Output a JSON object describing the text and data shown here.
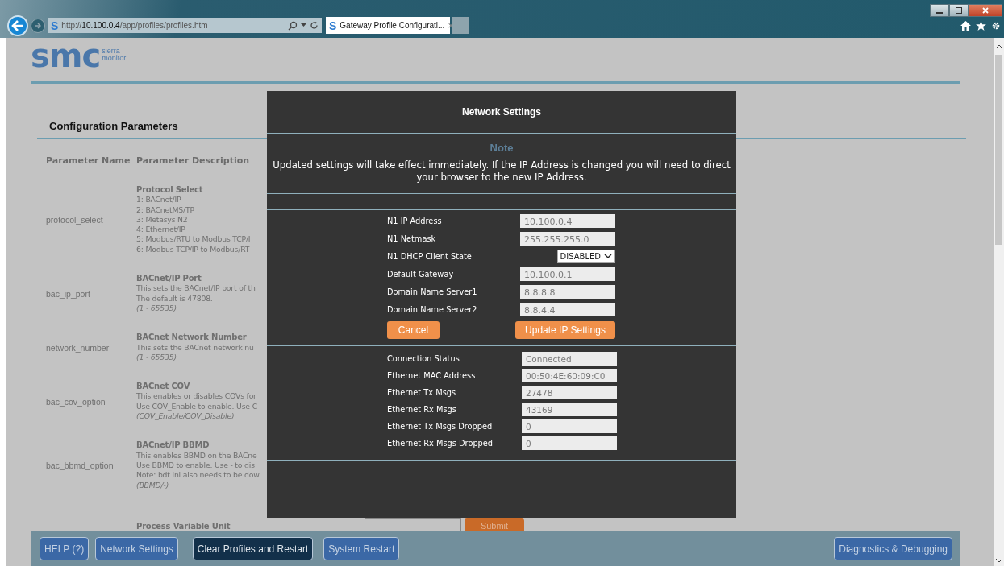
{
  "browser": {
    "favicon": "S",
    "tab_favicon": "S",
    "address_host": "10.100.0.4",
    "address_prefix": "http://",
    "address_path": "/app/profiles/profiles.htm",
    "tab_title": "Gateway Profile Configurati...",
    "tab_close": "×"
  },
  "logo": {
    "letters": "smc",
    "tagline_1": "sierra",
    "tagline_2": "monitor"
  },
  "page": {
    "heading": "Configuration Parameters",
    "columns": [
      "Parameter Name",
      "Parameter Description"
    ],
    "rows": [
      {
        "name": "protocol_select",
        "title": "Protocol Select",
        "lines": [
          "1: BACnet/IP",
          "2: BACnetMS/TP",
          "3: Metasys N2",
          "4: Ethernet/IP",
          "5: Modbus/RTU to Modbus TCP/I",
          "6: Modbus TCP/IP to Modbus/RT"
        ],
        "range": ""
      },
      {
        "name": "bac_ip_port",
        "title": "BACnet/IP Port",
        "lines": [
          "This sets the BACnet/IP port of th",
          "The default is 47808."
        ],
        "range": "(1 - 65535)"
      },
      {
        "name": "network_number",
        "title": "BACnet Network Number",
        "lines": [
          "This sets the BACnet network nu"
        ],
        "range": "(1 - 65535)"
      },
      {
        "name": "bac_cov_option",
        "title": "BACnet COV",
        "lines": [
          "This enables or disables COVs for",
          "Use COV_Enable to enable. Use C"
        ],
        "range": "(COV_Enable/COV_Disable)"
      },
      {
        "name": "bac_bbmd_option",
        "title": "BACnet/IP BBMD",
        "lines": [
          "This enables BBMD on the BACne",
          "Use BBMD to enable. Use - to dis",
          "Note: bdt.ini also needs to be dow"
        ],
        "range": "(BBMD/-)"
      },
      {
        "name": "",
        "title": "Process Variable Unit",
        "lines": [],
        "range": "",
        "submit": "Submit"
      }
    ]
  },
  "modal": {
    "title": "Network Settings",
    "note_heading": "Note",
    "note": "Updated settings will take effect immediately. If the IP Address is changed you will need to direct your browser to the new IP Address.",
    "settings": [
      {
        "kind": "text",
        "label": "N1 IP Address",
        "value": "10.100.0.4"
      },
      {
        "kind": "text",
        "label": "N1 Netmask",
        "value": "255.255.255.0"
      },
      {
        "kind": "select",
        "label": "N1 DHCP Client State",
        "value": "DISABLED"
      },
      {
        "kind": "text",
        "label": "Default Gateway",
        "value": "10.100.0.1"
      },
      {
        "kind": "text",
        "label": "Domain Name Server1",
        "value": "8.8.8.8"
      },
      {
        "kind": "text",
        "label": "Domain Name Server2",
        "value": "8.8.4.4"
      }
    ],
    "buttons": [
      "Cancel",
      "Update IP Settings"
    ],
    "status": [
      {
        "label": "Connection Status",
        "value": "Connected"
      },
      {
        "label": "Ethernet MAC Address",
        "value": "00:50:4E:60:09:C0"
      },
      {
        "label": "Ethernet Tx Msgs",
        "value": "27478"
      },
      {
        "label": "Ethernet Rx Msgs",
        "value": "43169"
      },
      {
        "label": "Ethernet Tx Msgs Dropped",
        "value": "0"
      },
      {
        "label": "Ethernet Rx Msgs Dropped",
        "value": "0"
      }
    ]
  },
  "footer": {
    "buttons": [
      {
        "label": "HELP (?)",
        "selected": false
      },
      {
        "label": "Network Settings",
        "selected": false
      },
      {
        "label": "Clear Profiles and Restart",
        "selected": true
      },
      {
        "label": "System Restart",
        "selected": false
      }
    ],
    "right_button": "Diagnostics & Debugging"
  }
}
